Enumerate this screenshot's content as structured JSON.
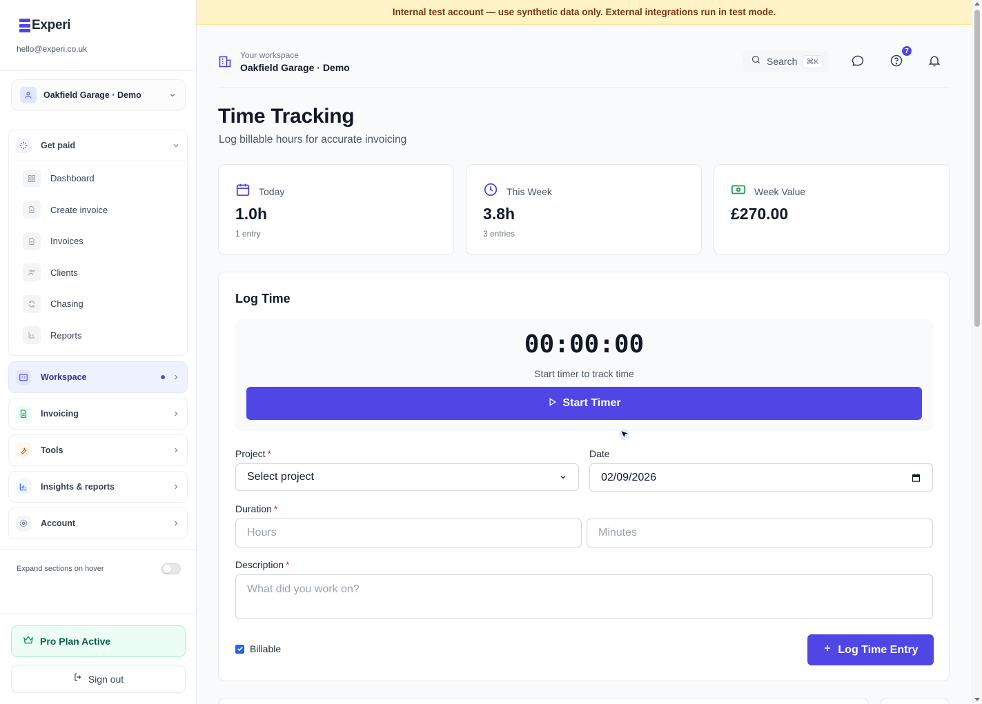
{
  "brand": {
    "name": "Experi",
    "email": "hello@experi.co.uk"
  },
  "sidebar": {
    "workspace_selector": "Oakfield Garage · Demo",
    "get_paid": {
      "label": "Get paid",
      "items": [
        {
          "label": "Dashboard",
          "icon": "grid-icon"
        },
        {
          "label": "Create invoice",
          "icon": "file-plus-icon"
        },
        {
          "label": "Invoices",
          "icon": "file-text-icon"
        },
        {
          "label": "Clients",
          "icon": "users-icon"
        },
        {
          "label": "Chasing",
          "icon": "refresh-icon"
        },
        {
          "label": "Reports",
          "icon": "bar-chart-icon"
        }
      ]
    },
    "sections": [
      {
        "label": "Workspace",
        "icon": "building-icon",
        "active": true
      },
      {
        "label": "Invoicing",
        "icon": "document-icon"
      },
      {
        "label": "Tools",
        "icon": "wrench-icon"
      },
      {
        "label": "Insights & reports",
        "icon": "chart-icon"
      },
      {
        "label": "Account",
        "icon": "gear-icon"
      }
    ],
    "expand_hover_label": "Expand sections on hover",
    "expand_hover_enabled": false,
    "plan_label": "Pro Plan Active",
    "sign_out_label": "Sign out"
  },
  "banner": {
    "text": "Internal test account — use synthetic data only. External integrations run in test mode."
  },
  "header": {
    "workspace_caption": "Your workspace",
    "workspace_name": "Oakfield Garage · Demo",
    "search_label": "Search",
    "search_shortcut": "⌘K",
    "help_badge": "7"
  },
  "page": {
    "title": "Time Tracking",
    "subtitle": "Log billable hours for accurate invoicing"
  },
  "stats": [
    {
      "label": "Today",
      "value": "1.0h",
      "count": "1 entry",
      "icon": "calendar-icon",
      "color": "#4f46e5"
    },
    {
      "label": "This Week",
      "value": "3.8h",
      "count": "3 entries",
      "icon": "clock-icon",
      "color": "#4f46e5"
    },
    {
      "label": "Week Value",
      "value": "£270.00",
      "count": "",
      "icon": "banknote-icon",
      "color": "#16a34a"
    }
  ],
  "log_time": {
    "title": "Log Time",
    "timer": "00:00:00",
    "timer_hint": "Start timer to track time",
    "start_label": "Start Timer",
    "project_label": "Project",
    "project_value": "Select project",
    "date_label": "Date",
    "date_value": "02/09/2026",
    "duration_label": "Duration",
    "hours_placeholder": "Hours",
    "minutes_placeholder": "Minutes",
    "description_label": "Description",
    "description_placeholder": "What did you work on?",
    "billable_label": "Billable",
    "billable_checked": true,
    "submit_label": "Log Time Entry",
    "required_mark": "*"
  },
  "colors": {
    "accent": "#4f46e5",
    "success": "#16a34a",
    "banner_bg": "#fef3c7"
  }
}
